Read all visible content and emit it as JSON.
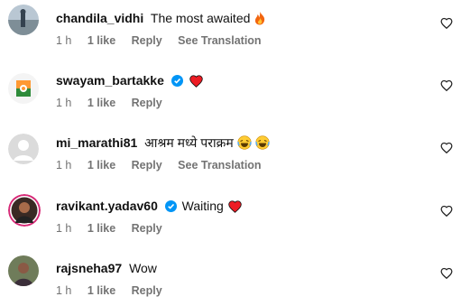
{
  "comments": [
    {
      "username": "chandila_vidhi",
      "verified": false,
      "text": "The most awaited",
      "emoji": "fire-icon",
      "time": "1 h",
      "likes": "1 like",
      "reply": "Reply",
      "translate": "See Translation",
      "avatar": "beach-photo"
    },
    {
      "username": "swayam_bartakke",
      "verified": true,
      "text": "",
      "emoji": "heart-icon",
      "time": "1 h",
      "likes": "1 like",
      "reply": "Reply",
      "avatar": "party-flag-logo"
    },
    {
      "username": "mi_marathi81",
      "verified": false,
      "text": "आश्रम मध्ये पराक्रम",
      "emoji": "laughing-emoji-x2",
      "time": "1 h",
      "likes": "1 like",
      "reply": "Reply",
      "translate": "See Translation",
      "avatar": "default-avatar"
    },
    {
      "username": "ravikant.yadav60",
      "verified": true,
      "text": "Waiting",
      "emoji": "heart-icon",
      "time": "1 h",
      "likes": "1 like",
      "reply": "Reply",
      "avatar": "portrait-photo"
    },
    {
      "username": "rajsneha97",
      "verified": false,
      "text": "Wow",
      "emoji": "",
      "time": "1 h",
      "likes": "1 like",
      "reply": "Reply",
      "avatar": "portrait-photo"
    }
  ],
  "colors": {
    "verified": "#0095f6",
    "heart": "#ed1c24",
    "meta": "#737373"
  }
}
